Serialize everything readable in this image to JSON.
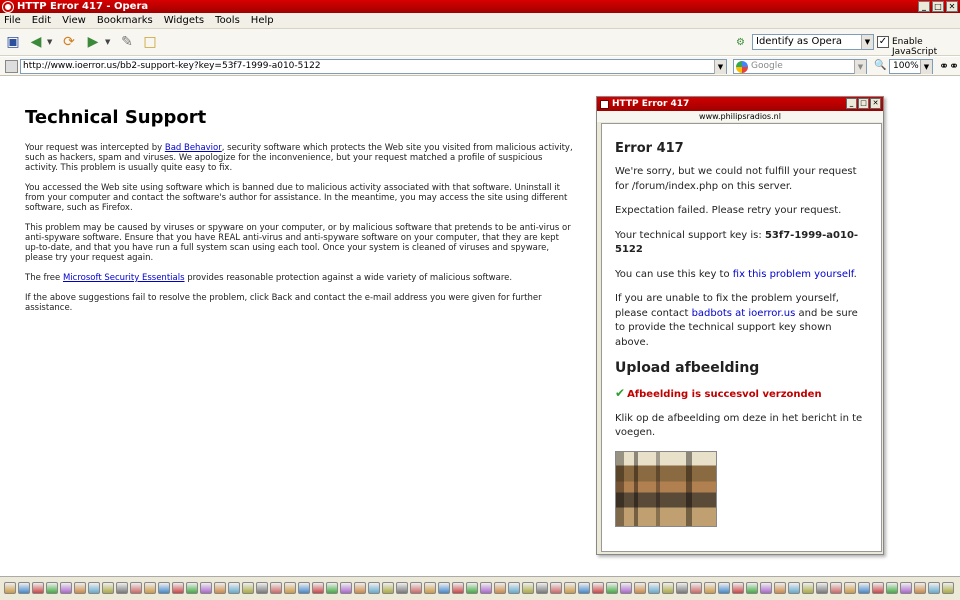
{
  "window": {
    "title": "HTTP Error 417 - Opera",
    "buttons": [
      "_",
      "□",
      "✕"
    ]
  },
  "menu": [
    "File",
    "Edit",
    "View",
    "Bookmarks",
    "Widgets",
    "Tools",
    "Help"
  ],
  "toolbar": {
    "identify_value": "Identify as Opera",
    "javascript_label": "Enable JavaScript",
    "javascript_checked": true
  },
  "addressbar": {
    "url": "http://www.ioerror.us/bb2-support-key?key=53f7-1999-a010-5122",
    "search_placeholder": "Google",
    "zoom": "100%"
  },
  "page": {
    "heading": "Technical Support",
    "p1_a": "Your request was intercepted by ",
    "p1_link": "Bad Behavior",
    "p1_b": ", security software which protects the Web site you visited from malicious activity, such as hackers, spam and viruses. We apologize for the inconvenience, but your request matched a profile of suspicious activity. This problem is usually quite easy to fix.",
    "p2": "You accessed the Web site using software which is banned due to malicious activity associated with that software. Uninstall it from your computer and contact the software's author for assistance. In the meantime, you may access the site using different software, such as Firefox.",
    "p3": "This problem may be caused by viruses or spyware on your computer, or by malicious software that pretends to be anti-virus or anti-spyware software. Ensure that you have REAL anti-virus and anti-spyware software on your computer, that they are kept up-to-date, and that you have run a full system scan using each tool. Once your system is cleaned of viruses and spyware, please try your request again.",
    "p4_a": "The free ",
    "p4_link": "Microsoft Security Essentials",
    "p4_b": " provides reasonable protection against a wide variety of malicious software.",
    "p5": "If the above suggestions fail to resolve the problem, click Back and contact the e-mail address you were given for further assistance."
  },
  "popup": {
    "title": "HTTP Error 417",
    "url": "www.philipsradios.nl",
    "heading": "Error 417",
    "sorry": "We're sorry, but we could not fulfill your request for /forum/index.php on this server.",
    "expectation": "Expectation failed. Please retry your request.",
    "key_text": "Your technical support key is: ",
    "key_value": "53f7-1999-a010-5122",
    "use_key_a": "You can use this key to ",
    "use_key_link": "fix this problem yourself",
    "use_key_b": ".",
    "unable_a": "If you are unable to fix the problem yourself, please contact ",
    "unable_link": "badbots at ioerror.us",
    "unable_b": " and be sure to provide the technical support key shown above.",
    "upload_heading": "Upload afbeelding",
    "success": "Afbeelding is succesvol verzonden",
    "instruction": "Klik op de afbeelding om deze in het bericht in te voegen."
  },
  "colors": {
    "titlebar": "#c00000",
    "link": "#0000cc",
    "success": "#c00000"
  }
}
